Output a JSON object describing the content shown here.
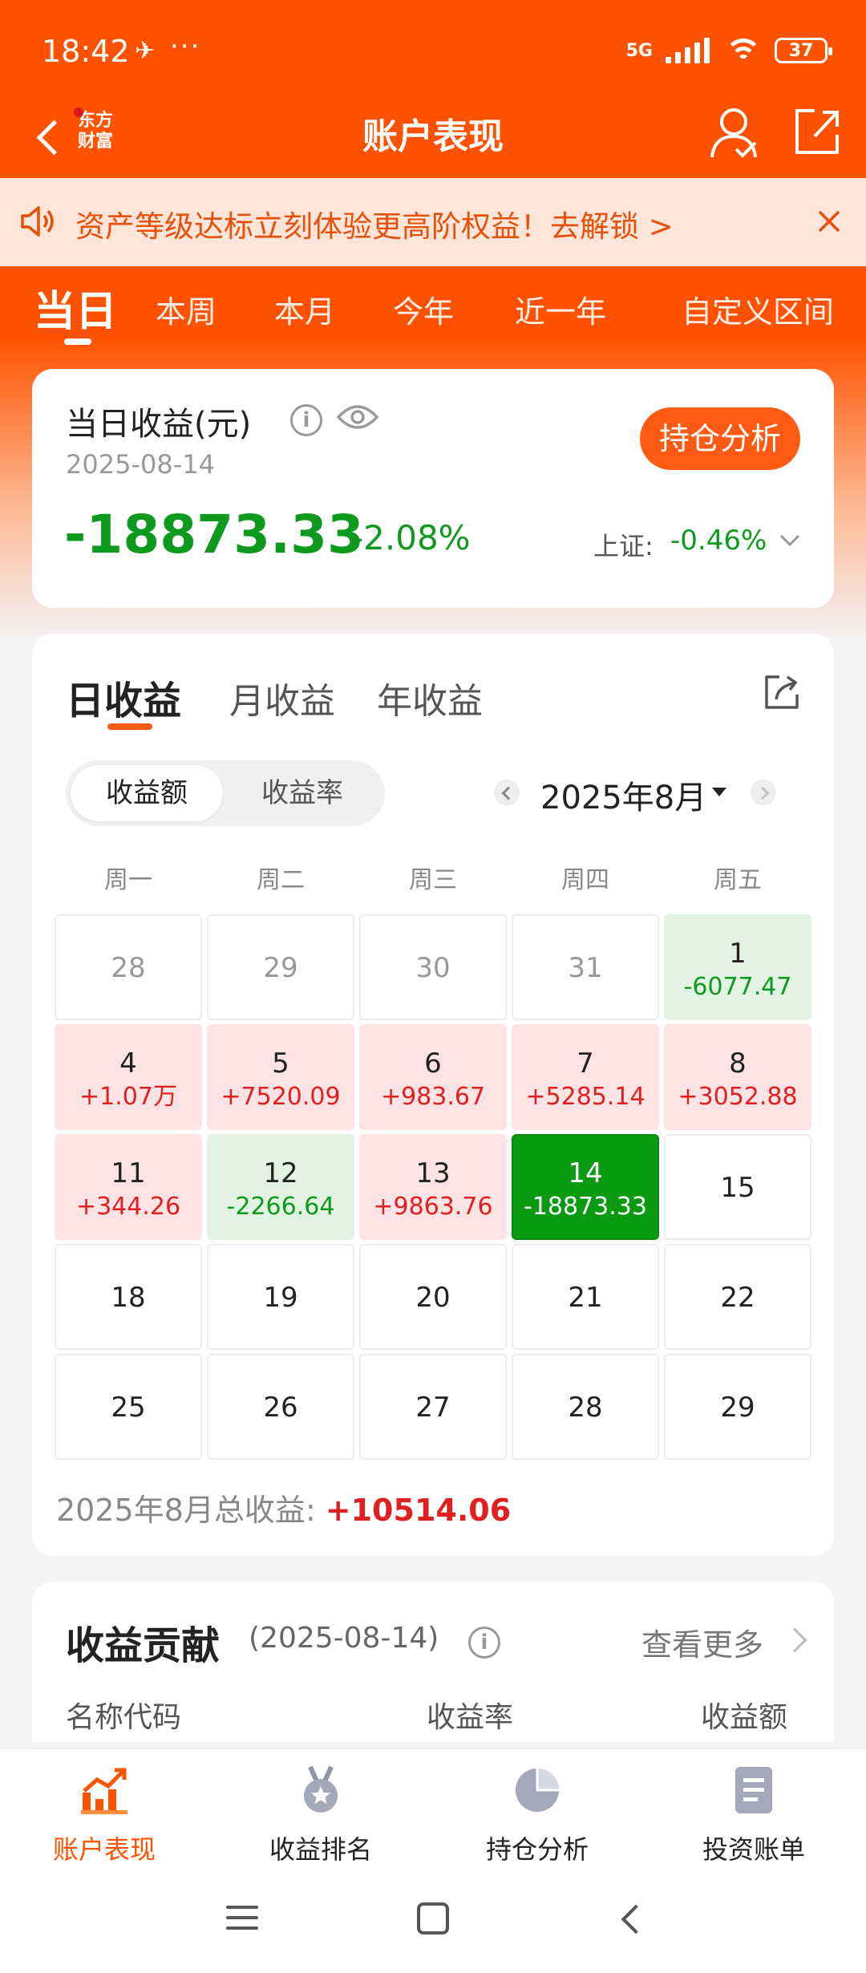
{
  "status_bar": {
    "time": "18:42",
    "network": "5G",
    "battery": "37"
  },
  "nav": {
    "title": "账户表现",
    "logo_line1": "东方",
    "logo_line2": "财富"
  },
  "notice": {
    "text": "资产等级达标立刻体验更高阶权益！去解锁 >"
  },
  "period_tabs": [
    "当日",
    "本周",
    "本月",
    "今年",
    "近一年",
    "自定义区间"
  ],
  "profit_card": {
    "title": "当日收益(元)",
    "info": "i",
    "date": "2025-08-14",
    "position_button": "持仓分析",
    "amount": "-18873.33",
    "percent": "-2.08%",
    "index_label": "上证:",
    "index_value": "-0.46%"
  },
  "calendar": {
    "tabs": [
      "日收益",
      "月收益",
      "年收益"
    ],
    "segment": [
      "收益额",
      "收益率"
    ],
    "month_label": "2025年8月",
    "weekdays": [
      "周一",
      "周二",
      "周三",
      "周四",
      "周五"
    ],
    "weeks": [
      [
        {
          "day": "28",
          "value": "",
          "state": "other"
        },
        {
          "day": "29",
          "value": "",
          "state": "other"
        },
        {
          "day": "30",
          "value": "",
          "state": "other"
        },
        {
          "day": "31",
          "value": "",
          "state": "other"
        },
        {
          "day": "1",
          "value": "-6077.47",
          "state": "down"
        }
      ],
      [
        {
          "day": "4",
          "value": "+1.07万",
          "state": "up"
        },
        {
          "day": "5",
          "value": "+7520.09",
          "state": "up"
        },
        {
          "day": "6",
          "value": "+983.67",
          "state": "up"
        },
        {
          "day": "7",
          "value": "+5285.14",
          "state": "up"
        },
        {
          "day": "8",
          "value": "+3052.88",
          "state": "up"
        }
      ],
      [
        {
          "day": "11",
          "value": "+344.26",
          "state": "up"
        },
        {
          "day": "12",
          "value": "-2266.64",
          "state": "down"
        },
        {
          "day": "13",
          "value": "+9863.76",
          "state": "up"
        },
        {
          "day": "14",
          "value": "-18873.33",
          "state": "today"
        },
        {
          "day": "15",
          "value": "",
          "state": "plain"
        }
      ],
      [
        {
          "day": "18",
          "value": "",
          "state": "plain"
        },
        {
          "day": "19",
          "value": "",
          "state": "plain"
        },
        {
          "day": "20",
          "value": "",
          "state": "plain"
        },
        {
          "day": "21",
          "value": "",
          "state": "plain"
        },
        {
          "day": "22",
          "value": "",
          "state": "plain"
        }
      ],
      [
        {
          "day": "25",
          "value": "",
          "state": "plain"
        },
        {
          "day": "26",
          "value": "",
          "state": "plain"
        },
        {
          "day": "27",
          "value": "",
          "state": "plain"
        },
        {
          "day": "28",
          "value": "",
          "state": "plain"
        },
        {
          "day": "29",
          "value": "",
          "state": "plain"
        }
      ]
    ],
    "total_label": "2025年8月总收益:",
    "total_value": "+10514.06"
  },
  "contribution": {
    "title": "收益贡献",
    "date": "(2025-08-14)",
    "more": "查看更多",
    "columns": [
      "名称代码",
      "收益率",
      "收益额"
    ]
  },
  "bottom_nav": [
    {
      "label": "账户表现",
      "icon": "chart-icon",
      "active": true
    },
    {
      "label": "收益排名",
      "icon": "medal-icon",
      "active": false
    },
    {
      "label": "持仓分析",
      "icon": "pie-icon",
      "active": false
    },
    {
      "label": "投资账单",
      "icon": "bill-icon",
      "active": false
    }
  ],
  "colors": {
    "brand": "#ff5200",
    "up": "#e02020",
    "down": "#0e9a1e"
  }
}
